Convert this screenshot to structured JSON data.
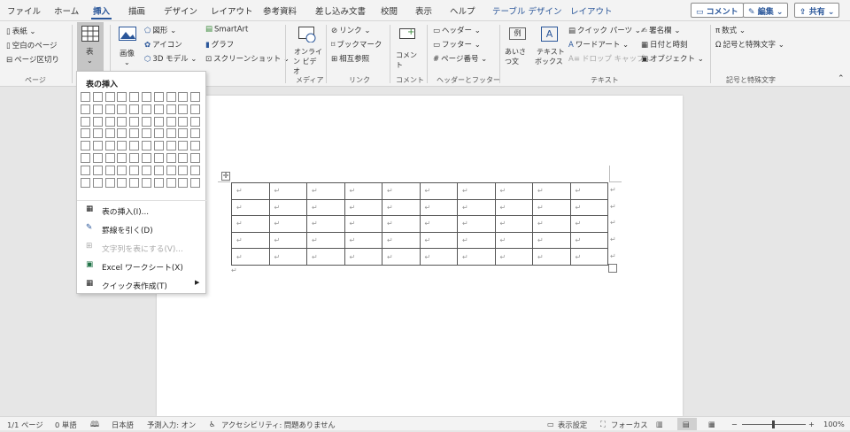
{
  "tabs": [
    "ファイル",
    "ホーム",
    "挿入",
    "描画",
    "デザイン",
    "レイアウト",
    "参考資料",
    "差し込み文書",
    "校閲",
    "表示",
    "ヘルプ",
    "テーブル デザイン",
    "レイアウト"
  ],
  "top_buttons": {
    "comment": "コメント",
    "edit": "編集",
    "share": "共有"
  },
  "ribbon": {
    "page": {
      "cover": "表紙",
      "blank": "空白のページ",
      "break": "ページ区切り",
      "group": "ページ"
    },
    "table": {
      "label": "表"
    },
    "illust": {
      "image": "画像",
      "shapes": "図形",
      "icons": "アイコン",
      "model": "3D モデル",
      "smartart": "SmartArt",
      "graph": "グラフ",
      "screenshot": "スクリーンショット"
    },
    "media": {
      "online1": "オンライ",
      "online2": "ン ビデオ",
      "group": "メディア"
    },
    "link": {
      "link": "リンク",
      "bookmark": "ブックマーク",
      "crossref": "相互参照",
      "group": "リンク"
    },
    "comment": {
      "label": "コメント",
      "group": "コメント"
    },
    "header": {
      "header": "ヘッダー",
      "footer": "フッター",
      "pagenum": "ページ番号",
      "group": "ヘッダーとフッター"
    },
    "text": {
      "greet1": "あいさつ",
      "greet2": "文",
      "greet_box": "例",
      "textbox1": "テキスト",
      "textbox2": "ボックス",
      "textbox_icon": "A",
      "quick": "クイック パーツ",
      "wordart": "ワードアート",
      "dropcap": "ドロップ キャップ",
      "sig": "署名欄",
      "date": "日付と時刻",
      "object": "オブジェクト",
      "group": "テキスト"
    },
    "symbol": {
      "eq": "数式",
      "sym": "記号と特殊文字",
      "group": "記号と特殊文字"
    }
  },
  "dropdown": {
    "title": "表の挿入",
    "grid_cols": 10,
    "grid_rows": 8,
    "items": [
      {
        "label": "表の挿入(I)...",
        "disabled": false
      },
      {
        "label": "罫線を引く(D)",
        "disabled": false
      },
      {
        "label": "文字列を表にする(V)...",
        "disabled": true
      },
      {
        "label": "Excel ワークシート(X)",
        "disabled": false
      },
      {
        "label": "クイック表作成(T)",
        "disabled": false,
        "submenu": true
      }
    ]
  },
  "document": {
    "table_rows": 5,
    "table_cols": 10,
    "cell_mark": "↵",
    "para_mark": "↵"
  },
  "status": {
    "page": "1/1 ページ",
    "words": "0 単語",
    "lang": "日本語",
    "predict": "予測入力: オン",
    "access": "アクセシビリティ: 問題ありません",
    "display": "表示設定",
    "focus": "フォーカス",
    "zoom": "100%",
    "zoom_minus": "−",
    "zoom_plus": "+"
  }
}
